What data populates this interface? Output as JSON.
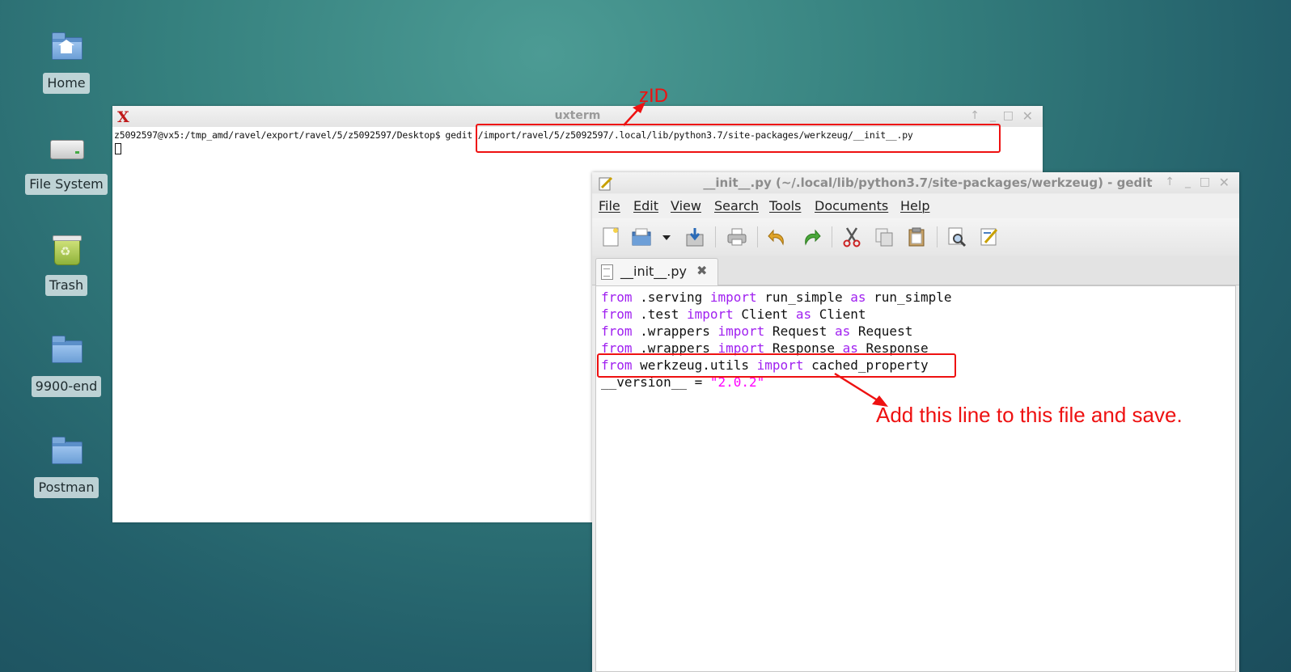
{
  "desktop": {
    "icons": [
      {
        "label": "Home",
        "icon": "home-folder-icon"
      },
      {
        "label": "File System",
        "icon": "drive-icon"
      },
      {
        "label": "Trash",
        "icon": "trash-icon"
      },
      {
        "label": "9900-end",
        "icon": "folder-icon"
      },
      {
        "label": "Postman",
        "icon": "folder-icon"
      }
    ]
  },
  "terminal": {
    "title": "uxterm",
    "prompt": "z5092597@vx5:/tmp_amd/ravel/export/ravel/5/z5092597/Desktop$",
    "command": "gedit /import/ravel/5/z5092597/.local/lib/python3.7/site-packages/werkzeug/__init__.py"
  },
  "gedit": {
    "title": "__init__.py (~/.local/lib/python3.7/site-packages/werkzeug) - gedit",
    "menu": [
      "File",
      "Edit",
      "View",
      "Search",
      "Tools",
      "Documents",
      "Help"
    ],
    "tab_label": "__init__.py",
    "code": {
      "l1": {
        "a": "from",
        "b": " .serving ",
        "c": "import",
        "d": " run_simple ",
        "e": "as",
        "f": " run_simple"
      },
      "l2": {
        "a": "from",
        "b": " .test ",
        "c": "import",
        "d": " Client ",
        "e": "as",
        "f": " Client"
      },
      "l3": {
        "a": "from",
        "b": " .wrappers ",
        "c": "import",
        "d": " Request ",
        "e": "as",
        "f": " Request"
      },
      "l4": {
        "a": "from",
        "b": " .wrappers ",
        "c": "import",
        "d": " Response ",
        "e": "as",
        "f": " Response"
      },
      "l5": {
        "a": "from",
        "b": " werkzeug.utils ",
        "c": "import",
        "d": " cached_property"
      },
      "l6": {
        "a": "__version__ = ",
        "b": "\"2.0.2\""
      }
    }
  },
  "annotations": {
    "zid_label": "zID",
    "note": "Add this line to this file and save.",
    "color": "#e11111"
  }
}
